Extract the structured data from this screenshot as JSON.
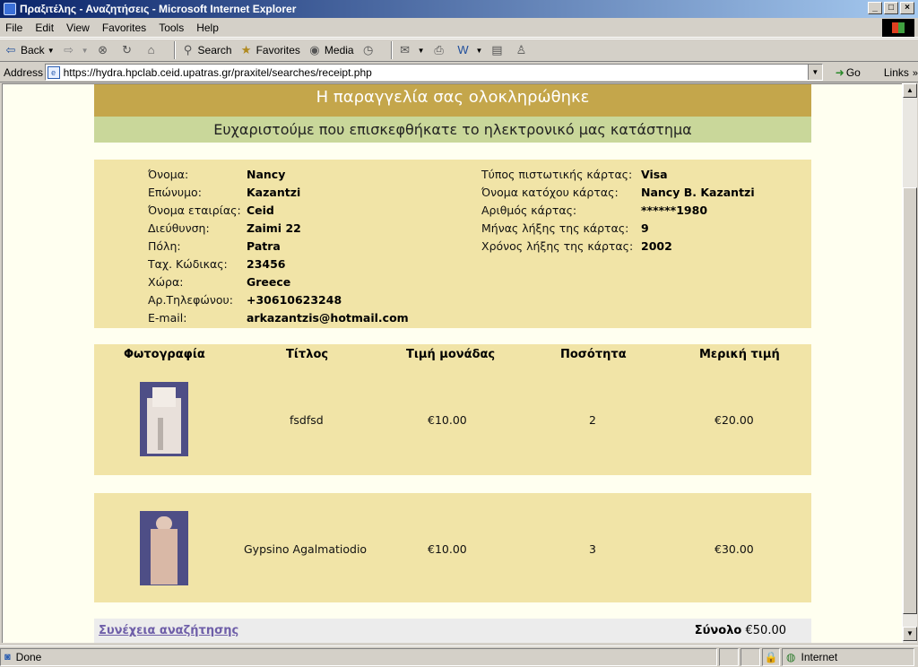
{
  "window": {
    "title": "Πραξιτέλης - Αναζητήσεις - Microsoft Internet Explorer"
  },
  "menu": [
    "File",
    "Edit",
    "View",
    "Favorites",
    "Tools",
    "Help"
  ],
  "toolbar": {
    "back": "Back",
    "search": "Search",
    "favorites": "Favorites",
    "media": "Media"
  },
  "address": {
    "label": "Address",
    "url": "https://hydra.hpclab.ceid.upatras.gr/praxitel/searches/receipt.php",
    "go": "Go",
    "links": "Links"
  },
  "page": {
    "header": "Η παραγγελία σας ολοκληρώθηκε",
    "subheader": "Ευχαριστούμε που επισκεφθήκατε το ηλεκτρονικό μας κατάστημα",
    "customer": [
      {
        "label": "Όνομα:",
        "value": "Nancy"
      },
      {
        "label": "Επώνυμο:",
        "value": "Kazantzi"
      },
      {
        "label": "Όνομα εταιρίας:",
        "value": "Ceid"
      },
      {
        "label": "Διεύθυνση:",
        "value": "Zaimi 22"
      },
      {
        "label": "Πόλη:",
        "value": "Patra"
      },
      {
        "label": "Ταχ. Κώδικας:",
        "value": "23456"
      },
      {
        "label": "Χώρα:",
        "value": "Greece"
      },
      {
        "label": "Αρ.Τηλεφώνου:",
        "value": "+30610623248"
      },
      {
        "label": "E-mail:",
        "value": "arkazantzis@hotmail.com"
      }
    ],
    "card": [
      {
        "label": "Τύπος πιστωτικής κάρτας:",
        "value": "Visa"
      },
      {
        "label": "Όνομα κατόχου κάρτας:",
        "value": "Nancy B. Kazantzi"
      },
      {
        "label": "Αριθμός κάρτας:",
        "value": "******1980"
      },
      {
        "label": "Μήνας λήξης της κάρτας:",
        "value": "9"
      },
      {
        "label": "Χρόνος λήξης της κάρτας:",
        "value": "2002"
      }
    ],
    "columns": [
      "Φωτογραφία",
      "Τίτλος",
      "Τιμή μονάδας",
      "Ποσότητα",
      "Μερική τιμή"
    ],
    "items": [
      {
        "title": "fsdfsd",
        "unit_price": "€10.00",
        "quantity": "2",
        "subtotal": "€20.00"
      },
      {
        "title": "Gypsino Agalmatiodio",
        "unit_price": "€10.00",
        "quantity": "3",
        "subtotal": "€30.00"
      }
    ],
    "continue_link": "Συνέχεια αναζήτησης",
    "total_label": "Σύνολο",
    "total_value": "€50.00"
  },
  "status": {
    "text": "Done",
    "zone": "Internet"
  }
}
